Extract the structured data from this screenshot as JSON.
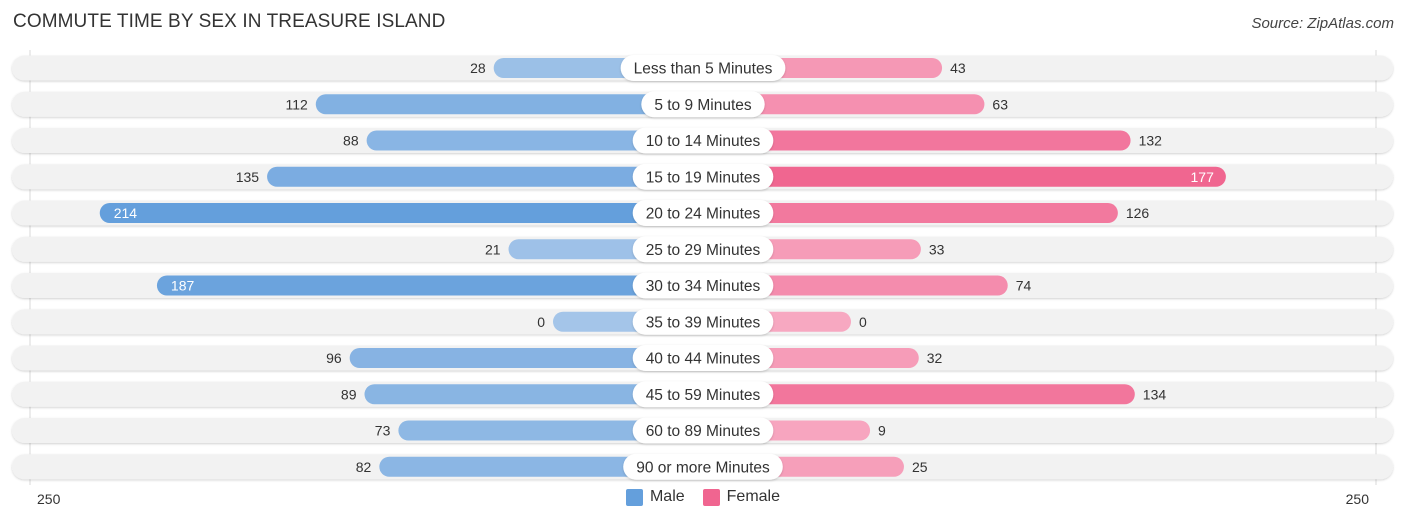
{
  "header": {
    "title": "COMMUTE TIME BY SEX IN TREASURE ISLAND",
    "source": "Source: ZipAtlas.com"
  },
  "colors": {
    "male_light": "#a4c5e9",
    "male_dark": "#649fdc",
    "female_light": "#f7a8c1",
    "female_dark": "#f06590",
    "track": "#f2f2f2"
  },
  "chart_data": {
    "type": "bar",
    "orientation": "horizontal-diverging",
    "title": "COMMUTE TIME BY SEX IN TREASURE ISLAND",
    "categories": [
      "Less than 5 Minutes",
      "5 to 9 Minutes",
      "10 to 14 Minutes",
      "15 to 19 Minutes",
      "20 to 24 Minutes",
      "25 to 29 Minutes",
      "30 to 34 Minutes",
      "35 to 39 Minutes",
      "40 to 44 Minutes",
      "45 to 59 Minutes",
      "60 to 89 Minutes",
      "90 or more Minutes"
    ],
    "series": [
      {
        "name": "Male",
        "side": "left",
        "values": [
          28,
          112,
          88,
          135,
          214,
          21,
          187,
          0,
          96,
          89,
          73,
          82
        ]
      },
      {
        "name": "Female",
        "side": "right",
        "values": [
          43,
          63,
          132,
          177,
          126,
          33,
          74,
          0,
          32,
          134,
          9,
          25
        ]
      }
    ],
    "axis": {
      "left_label": "250",
      "right_label": "250",
      "max": 250
    },
    "legend": {
      "position": "bottom-center",
      "entries": [
        "Male",
        "Female"
      ]
    },
    "xlabel": "",
    "ylabel": ""
  }
}
